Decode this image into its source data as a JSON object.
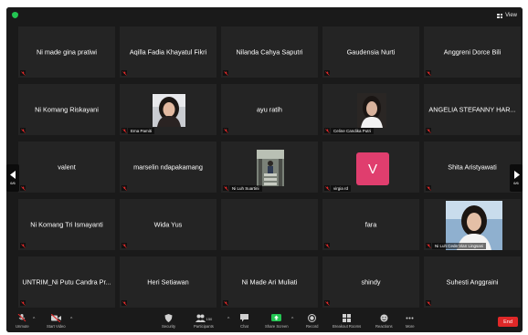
{
  "header": {
    "view_label": "View"
  },
  "participants": [
    {
      "name": "Ni made gina pratiwi",
      "kind": "name"
    },
    {
      "name": "Aqilla Fadia Khayatul Fikri",
      "kind": "name"
    },
    {
      "name": "Nilanda Cahya Saputri",
      "kind": "name"
    },
    {
      "name": "Gaudensia Nurti",
      "kind": "name"
    },
    {
      "name": "Anggreni Dorce Bili",
      "kind": "name"
    },
    {
      "name": "Ni Komang Riskayani",
      "kind": "name"
    },
    {
      "name": "Ema Pamiti",
      "kind": "photo"
    },
    {
      "name": "ayu ratih",
      "kind": "name"
    },
    {
      "name": "Celine Candika Putri",
      "kind": "photo"
    },
    {
      "name": "ANGELIA STEFANNY HAR...",
      "kind": "name"
    },
    {
      "name": "valent",
      "kind": "name"
    },
    {
      "name": "marselin ndapakamang",
      "kind": "name"
    },
    {
      "name": "Ni Luh Suartini",
      "kind": "photo"
    },
    {
      "name": "virgia rd",
      "kind": "avatar",
      "initial": "V"
    },
    {
      "name": "Shita Aristyawati",
      "kind": "name"
    },
    {
      "name": "Ni Komang Tri Ismayanti",
      "kind": "name"
    },
    {
      "name": "Wida Yus",
      "kind": "name"
    },
    {
      "name": "",
      "kind": "empty"
    },
    {
      "name": "fara",
      "kind": "name"
    },
    {
      "name": "Ni Luh Cede Vian Lingsani",
      "kind": "photo"
    },
    {
      "name": "UNTRIM_Ni Putu Candra Pr...",
      "kind": "name"
    },
    {
      "name": "Heri Setiawan",
      "kind": "name"
    },
    {
      "name": "Ni Made Ari Muliati",
      "kind": "name"
    },
    {
      "name": "shindy",
      "kind": "name"
    },
    {
      "name": "Suhesti Anggraini",
      "kind": "name"
    }
  ],
  "pagination": {
    "left": "6/6",
    "right": "6/6"
  },
  "toolbar": {
    "unmute": "Unmute",
    "start_video": "Start Video",
    "security": "Security",
    "participants": "Participants",
    "participants_count": "150",
    "chat": "Chat",
    "share_screen": "Share Screen",
    "record": "Record",
    "breakout_rooms": "Breakout Rooms",
    "reactions": "Reactions",
    "more": "More",
    "end": "End"
  },
  "colors": {
    "accent_green": "#23c552",
    "end_red": "#e02828",
    "avatar_pink": "#e03e6e"
  }
}
